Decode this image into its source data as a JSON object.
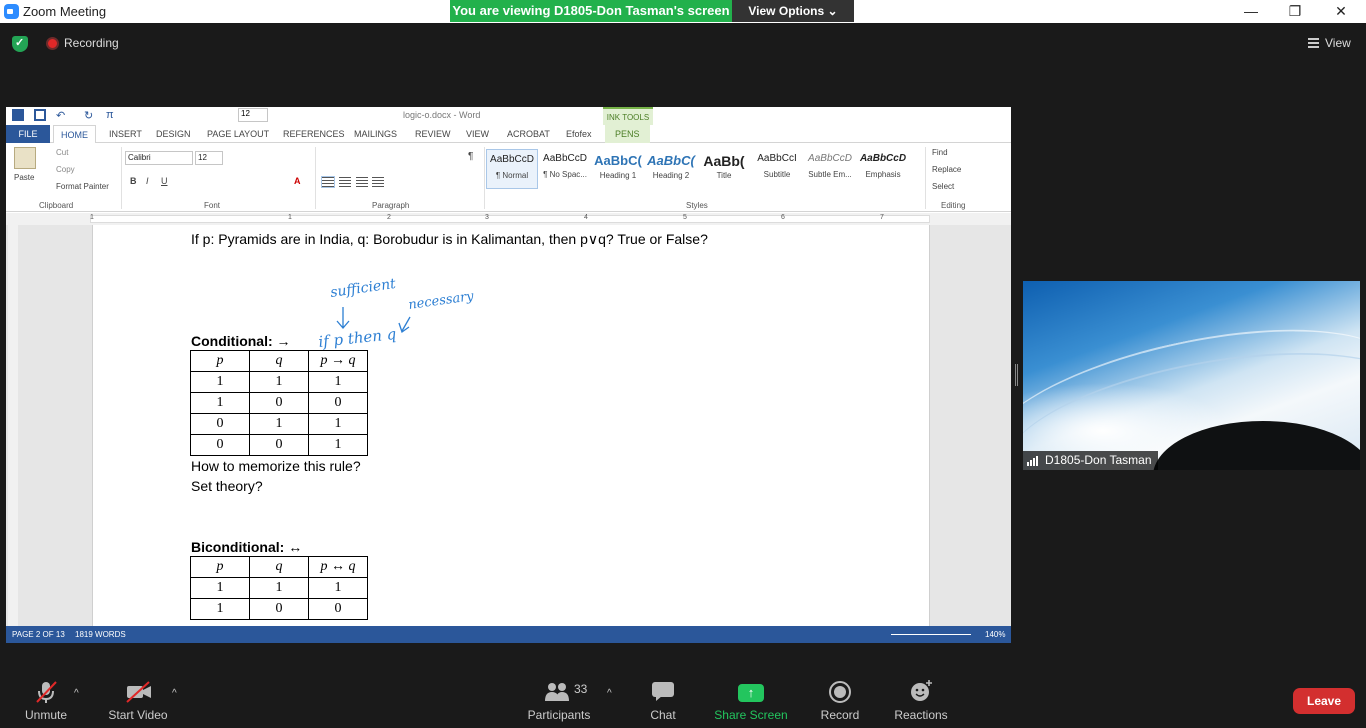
{
  "window": {
    "title": "Zoom Meeting",
    "banner_text": "You are viewing D1805-Don Tasman's screen",
    "view_options_label": "View Options",
    "minimize": "—",
    "restore": "❐",
    "close": "✕"
  },
  "topbar": {
    "recording_label": "Recording",
    "view_label": "View"
  },
  "word": {
    "doc_title": "logic-o.docx - Word",
    "ink_tools": "INK TOOLS",
    "tabs": [
      "FILE",
      "HOME",
      "INSERT",
      "DESIGN",
      "PAGE LAYOUT",
      "REFERENCES",
      "MAILINGS",
      "REVIEW",
      "VIEW",
      "ACROBAT",
      "Efofex",
      "PENS"
    ],
    "clipboard": {
      "paste": "Paste",
      "cut": "Cut",
      "copy": "Copy",
      "format_painter": "Format Painter",
      "group": "Clipboard"
    },
    "font": {
      "name": "Calibri",
      "size": "12",
      "group": "Font"
    },
    "paragraph_group": "Paragraph",
    "styles_group": "Styles",
    "styles": [
      {
        "sample": "AaBbCcD",
        "name": "¶ Normal"
      },
      {
        "sample": "AaBbCcD",
        "name": "¶ No Spac..."
      },
      {
        "sample": "AaBbC(",
        "name": "Heading 1"
      },
      {
        "sample": "AaBbC(",
        "name": "Heading 2"
      },
      {
        "sample": "AaBb(",
        "name": "Title"
      },
      {
        "sample": "AaBbCcI",
        "name": "Subtitle"
      },
      {
        "sample": "AaBbCcD",
        "name": "Subtle Em..."
      },
      {
        "sample": "AaBbCcD",
        "name": "Emphasis"
      }
    ],
    "editing": {
      "find": "Find",
      "replace": "Replace",
      "select": "Select",
      "group": "Editing"
    },
    "quick_size": "12",
    "ruler_numbers": [
      "1",
      "1",
      "2",
      "3",
      "4",
      "5",
      "6",
      "7"
    ],
    "doc": {
      "question": "If p: Pyramids are in India, q: Borobudur is in Kalimantan, then p∨q? True or False?",
      "conditional_heading": "Conditional: →",
      "conditional_table": {
        "headers": [
          "p",
          "q",
          "p → q"
        ],
        "rows": [
          [
            "1",
            "1",
            "1"
          ],
          [
            "1",
            "0",
            "0"
          ],
          [
            "0",
            "1",
            "1"
          ],
          [
            "0",
            "0",
            "1"
          ]
        ]
      },
      "memorize_line": "How to memorize this rule?",
      "set_theory_line": "Set theory?",
      "biconditional_heading": "Biconditional: ↔",
      "biconditional_table": {
        "headers": [
          "p",
          "q",
          "p ↔ q"
        ],
        "rows": [
          [
            "1",
            "1",
            "1"
          ],
          [
            "1",
            "0",
            "0"
          ]
        ]
      },
      "ink": {
        "sufficient": "sufficient",
        "necessary": "necessary",
        "if_p_then_q": "if p then q"
      }
    },
    "status": {
      "page": "PAGE 2 OF 13",
      "words": "1819 WORDS",
      "zoom": "140%"
    }
  },
  "video": {
    "participant_name": "D1805-Don Tasman"
  },
  "toolbar": {
    "unmute": "Unmute",
    "start_video": "Start Video",
    "participants": "Participants",
    "participants_count": "33",
    "chat": "Chat",
    "share_screen": "Share Screen",
    "record": "Record",
    "reactions": "Reactions",
    "leave": "Leave"
  }
}
